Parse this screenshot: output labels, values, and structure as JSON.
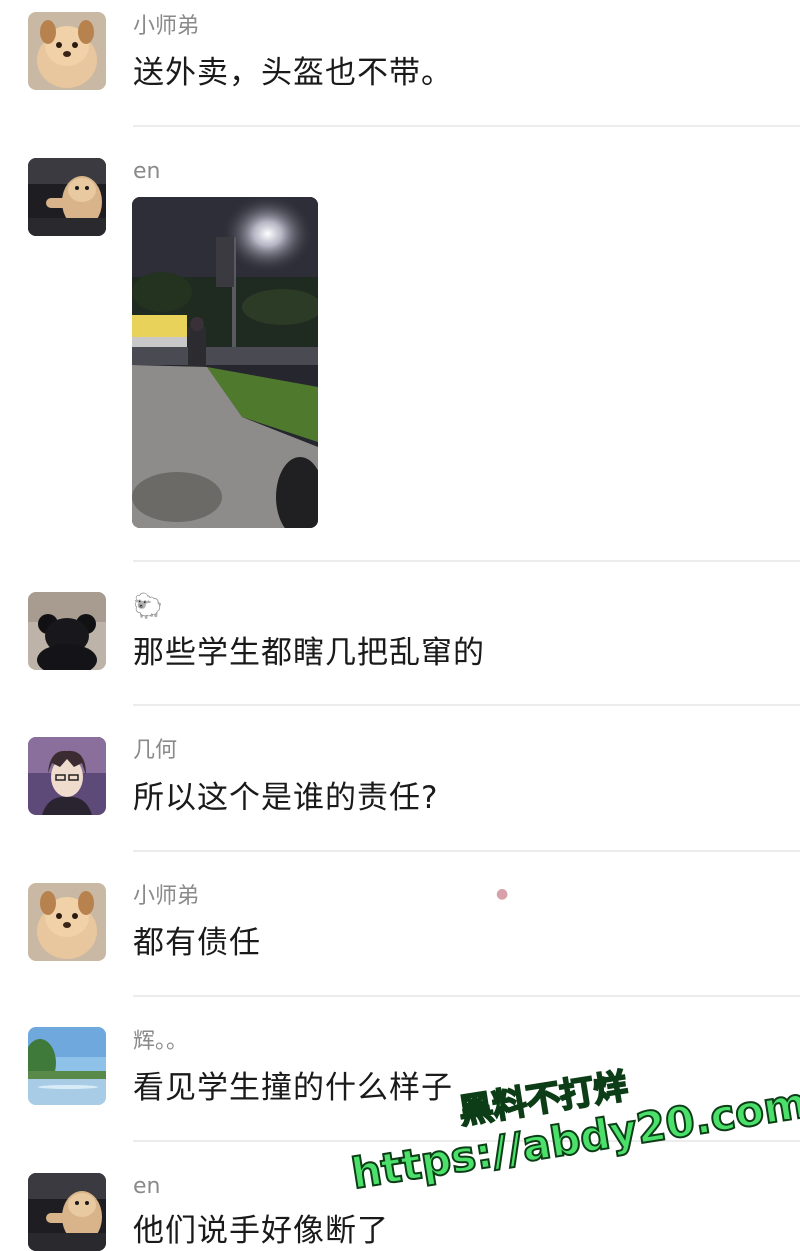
{
  "messages": [
    {
      "sender": "小师弟",
      "text": "送外卖，头盔也不带。",
      "avatar": "puppy-avatar"
    },
    {
      "sender": "en",
      "text": "",
      "avatar": "dog-in-car-avatar",
      "attachment": "night-street-photo"
    },
    {
      "sender": "🐑",
      "text": "那些学生都瞎几把乱窜的",
      "avatar": "black-bear-avatar"
    },
    {
      "sender": "几何",
      "text": "所以这个是谁的责任?",
      "avatar": "anime-boy-avatar"
    },
    {
      "sender": "小师弟",
      "text": "都有债任",
      "avatar": "puppy-avatar"
    },
    {
      "sender": "辉。。",
      "text": "看见学生撞的什么样子",
      "avatar": "lake-scenery-avatar"
    },
    {
      "sender": "en",
      "text": "他们说手好像断了",
      "avatar": "dog-in-car-avatar"
    }
  ],
  "watermark": {
    "line1": "黑料不打烊",
    "line2": "https://abdy20.com"
  },
  "colors": {
    "name": "#8a8a8a",
    "text": "#1a1a1a",
    "divider": "#ececec",
    "watermark_fill": "#4be06a",
    "watermark_stroke": "#0c3d16"
  }
}
